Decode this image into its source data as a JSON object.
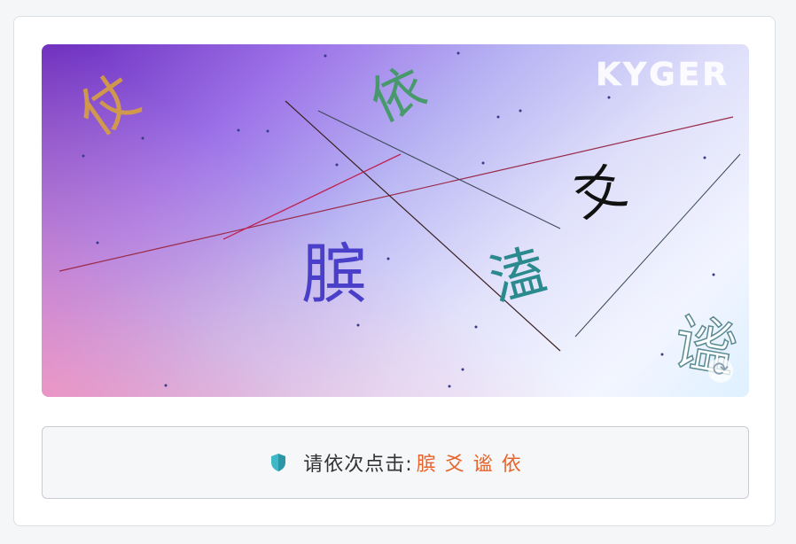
{
  "captcha": {
    "logo_text": "KYGER",
    "glyphs": [
      {
        "char": "仗",
        "color": "#d8a040"
      },
      {
        "char": "依",
        "color": "#3c9a5e"
      },
      {
        "char": "爻",
        "color": "#111111"
      },
      {
        "char": "膑",
        "color": "#4a3fc8"
      },
      {
        "char": "溘",
        "color": "#2a8a8e"
      },
      {
        "char": "谧",
        "color": "#6a9aa0"
      }
    ],
    "refresh_glyph": "⟳"
  },
  "prompt": {
    "instruction": "请依次点击:",
    "targets": [
      "膑",
      "爻",
      "谧",
      "依"
    ],
    "accent_color": "#e8632a",
    "shield_color": "#3fb8c8"
  }
}
